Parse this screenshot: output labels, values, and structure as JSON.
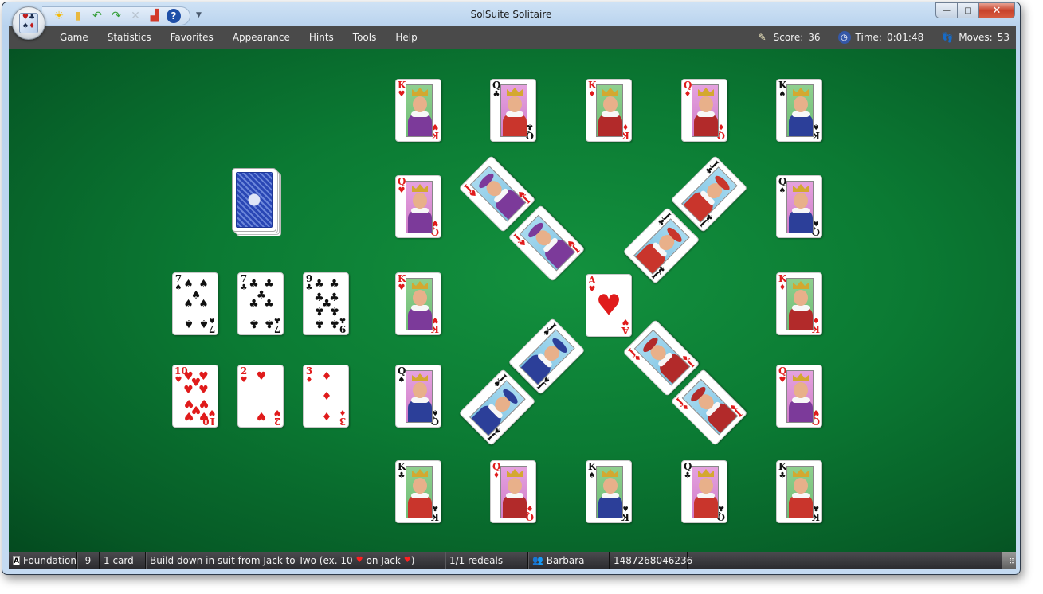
{
  "window": {
    "title": "SolSuite Solitaire",
    "controls": {
      "minimize": "—",
      "maximize": "□",
      "close": "✕"
    }
  },
  "quick_access": [
    {
      "name": "new-game-icon",
      "glyph": "☀",
      "color": "#f5b800"
    },
    {
      "name": "open-icon",
      "glyph": "▮",
      "color": "#e8b840"
    },
    {
      "name": "undo-icon",
      "glyph": "↶",
      "color": "#3aa040"
    },
    {
      "name": "redo-icon",
      "glyph": "↷",
      "color": "#3aa040"
    },
    {
      "name": "delete-icon",
      "glyph": "✕",
      "color": "#b9c4d0"
    },
    {
      "name": "statistics-icon",
      "glyph": "▟",
      "color": "#d23a2a"
    },
    {
      "name": "help-icon",
      "glyph": "?",
      "color": "#1f4fa8"
    }
  ],
  "menu": [
    "Game",
    "Statistics",
    "Favorites",
    "Appearance",
    "Hints",
    "Tools",
    "Help"
  ],
  "stats": {
    "score_label": "Score:",
    "score": "36",
    "time_label": "Time:",
    "time": "0:01:48",
    "moves_label": "Moves:",
    "moves": "53"
  },
  "board": {
    "stock": {
      "label": "stock-pile",
      "back_color": "#2a47b5"
    },
    "reserve_row1": [
      {
        "rank": "7",
        "suit": "♠",
        "color": "black"
      },
      {
        "rank": "7",
        "suit": "♣",
        "color": "black"
      },
      {
        "rank": "9",
        "suit": "♣",
        "color": "black"
      }
    ],
    "reserve_row2": [
      {
        "rank": "10",
        "suit": "♥",
        "color": "red"
      },
      {
        "rank": "2",
        "suit": "♥",
        "color": "red"
      },
      {
        "rank": "3",
        "suit": "♦",
        "color": "red"
      }
    ],
    "top_row": [
      {
        "rank": "K",
        "suit": "♥",
        "color": "red"
      },
      {
        "rank": "Q",
        "suit": "♣",
        "color": "black"
      },
      {
        "rank": "K",
        "suit": "♦",
        "color": "red"
      },
      {
        "rank": "Q",
        "suit": "♦",
        "color": "red"
      },
      {
        "rank": "K",
        "suit": "♠",
        "color": "black"
      }
    ],
    "left_column": [
      {
        "rank": "Q",
        "suit": "♥",
        "color": "red"
      },
      {
        "rank": "K",
        "suit": "♥",
        "color": "red"
      },
      {
        "rank": "Q",
        "suit": "♠",
        "color": "black"
      }
    ],
    "right_column": [
      {
        "rank": "Q",
        "suit": "♠",
        "color": "black"
      },
      {
        "rank": "K",
        "suit": "♦",
        "color": "red"
      },
      {
        "rank": "Q",
        "suit": "♥",
        "color": "red"
      }
    ],
    "bottom_row": [
      {
        "rank": "K",
        "suit": "♣",
        "color": "black"
      },
      {
        "rank": "Q",
        "suit": "♦",
        "color": "red"
      },
      {
        "rank": "K",
        "suit": "♠",
        "color": "black"
      },
      {
        "rank": "Q",
        "suit": "♣",
        "color": "black"
      },
      {
        "rank": "K",
        "suit": "♣",
        "color": "black"
      }
    ],
    "diagonal_jacks": [
      {
        "rank": "J",
        "suit": "♥",
        "color": "red"
      },
      {
        "rank": "J",
        "suit": "♥",
        "color": "red"
      },
      {
        "rank": "J",
        "suit": "♣",
        "color": "black"
      },
      {
        "rank": "J",
        "suit": "♣",
        "color": "black"
      },
      {
        "rank": "J",
        "suit": "♠",
        "color": "black"
      },
      {
        "rank": "J",
        "suit": "♠",
        "color": "black"
      },
      {
        "rank": "J",
        "suit": "♦",
        "color": "red"
      },
      {
        "rank": "J",
        "suit": "♦",
        "color": "red"
      }
    ],
    "center": {
      "rank": "A",
      "suit": "♥",
      "color": "red"
    }
  },
  "statusbar": {
    "pile_icon": "A",
    "pile": "Foundation",
    "count": "9",
    "cards": "1 card",
    "hint_prefix": "Build down in suit from Jack to Two (ex. 10",
    "hint_mid": "on Jack",
    "hint_suffix": ")",
    "heart": "♥",
    "redeals": "1/1 redeals",
    "player": "Barbara",
    "game_number": "1487268046236"
  }
}
